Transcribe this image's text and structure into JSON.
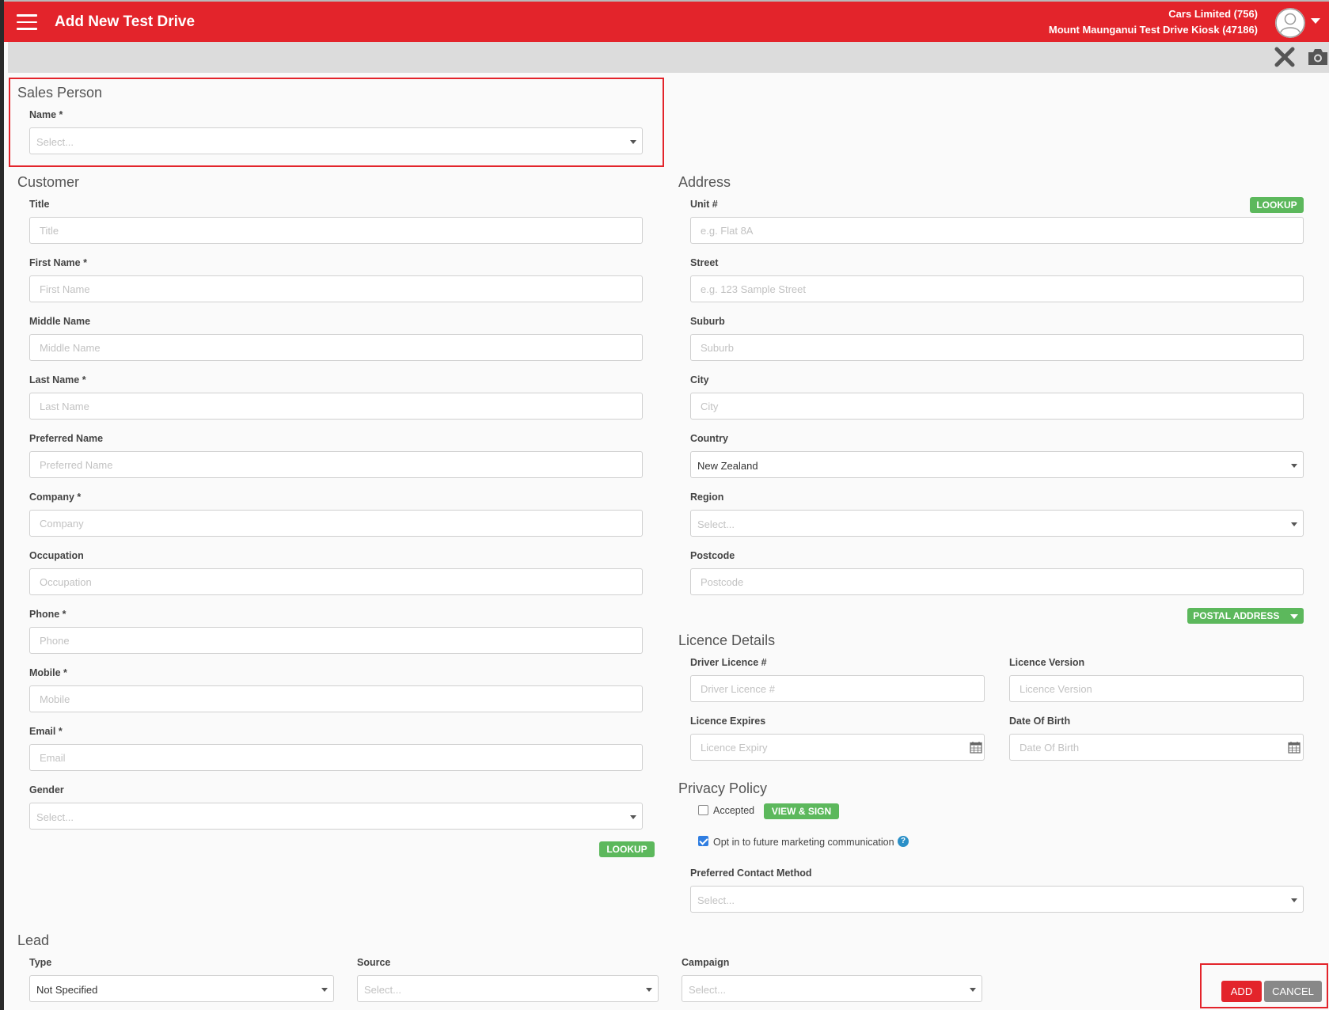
{
  "header": {
    "title": "Add New Test Drive",
    "org_line1": "Cars Limited (756)",
    "org_line2": "Mount Maunganui Test Drive Kiosk (47186)",
    "brand_color": "#e3242b"
  },
  "toolbar": {
    "icons": [
      "close-icon",
      "camera-icon"
    ]
  },
  "sales_person": {
    "title": "Sales Person",
    "name_label": "Name *",
    "name_placeholder": "Select..."
  },
  "customer": {
    "title": "Customer",
    "title_label": "Title",
    "title_placeholder": "Title",
    "first_name_label": "First Name *",
    "first_name_placeholder": "First Name",
    "middle_name_label": "Middle Name",
    "middle_name_placeholder": "Middle Name",
    "last_name_label": "Last Name *",
    "last_name_placeholder": "Last Name",
    "preferred_name_label": "Preferred Name",
    "preferred_name_placeholder": "Preferred Name",
    "company_label": "Company *",
    "company_placeholder": "Company",
    "occupation_label": "Occupation",
    "occupation_placeholder": "Occupation",
    "phone_label": "Phone *",
    "phone_placeholder": "Phone",
    "mobile_label": "Mobile *",
    "mobile_placeholder": "Mobile",
    "email_label": "Email *",
    "email_placeholder": "Email",
    "gender_label": "Gender",
    "gender_placeholder": "Select...",
    "lookup_label": "LOOKUP"
  },
  "address": {
    "title": "Address",
    "lookup_label": "LOOKUP",
    "unit_label": "Unit #",
    "unit_placeholder": "e.g. Flat 8A",
    "street_label": "Street",
    "street_placeholder": "e.g. 123 Sample Street",
    "suburb_label": "Suburb",
    "suburb_placeholder": "Suburb",
    "city_label": "City",
    "city_placeholder": "City",
    "country_label": "Country",
    "country_value": "New Zealand",
    "region_label": "Region",
    "region_placeholder": "Select...",
    "postcode_label": "Postcode",
    "postcode_placeholder": "Postcode",
    "postal_address_label": "POSTAL ADDRESS"
  },
  "licence": {
    "title": "Licence Details",
    "driver_licence_label": "Driver Licence #",
    "driver_licence_placeholder": "Driver Licence #",
    "licence_version_label": "Licence Version",
    "licence_version_placeholder": "Licence Version",
    "licence_expires_label": "Licence Expires",
    "licence_expires_placeholder": "Licence Expiry",
    "dob_label": "Date Of Birth",
    "dob_placeholder": "Date Of Birth"
  },
  "privacy": {
    "title": "Privacy Policy",
    "accepted_label": "Accepted",
    "accepted_checked": false,
    "view_sign_label": "VIEW & SIGN",
    "opt_in_label": "Opt in to future marketing communication",
    "opt_in_checked": true,
    "help_glyph": "?",
    "contact_method_label": "Preferred Contact Method",
    "contact_method_placeholder": "Select..."
  },
  "lead": {
    "title": "Lead",
    "type_label": "Type",
    "type_value": "Not Specified",
    "source_label": "Source",
    "source_placeholder": "Select...",
    "campaign_label": "Campaign",
    "campaign_placeholder": "Select..."
  },
  "actions": {
    "add_label": "ADD",
    "cancel_label": "CANCEL"
  }
}
